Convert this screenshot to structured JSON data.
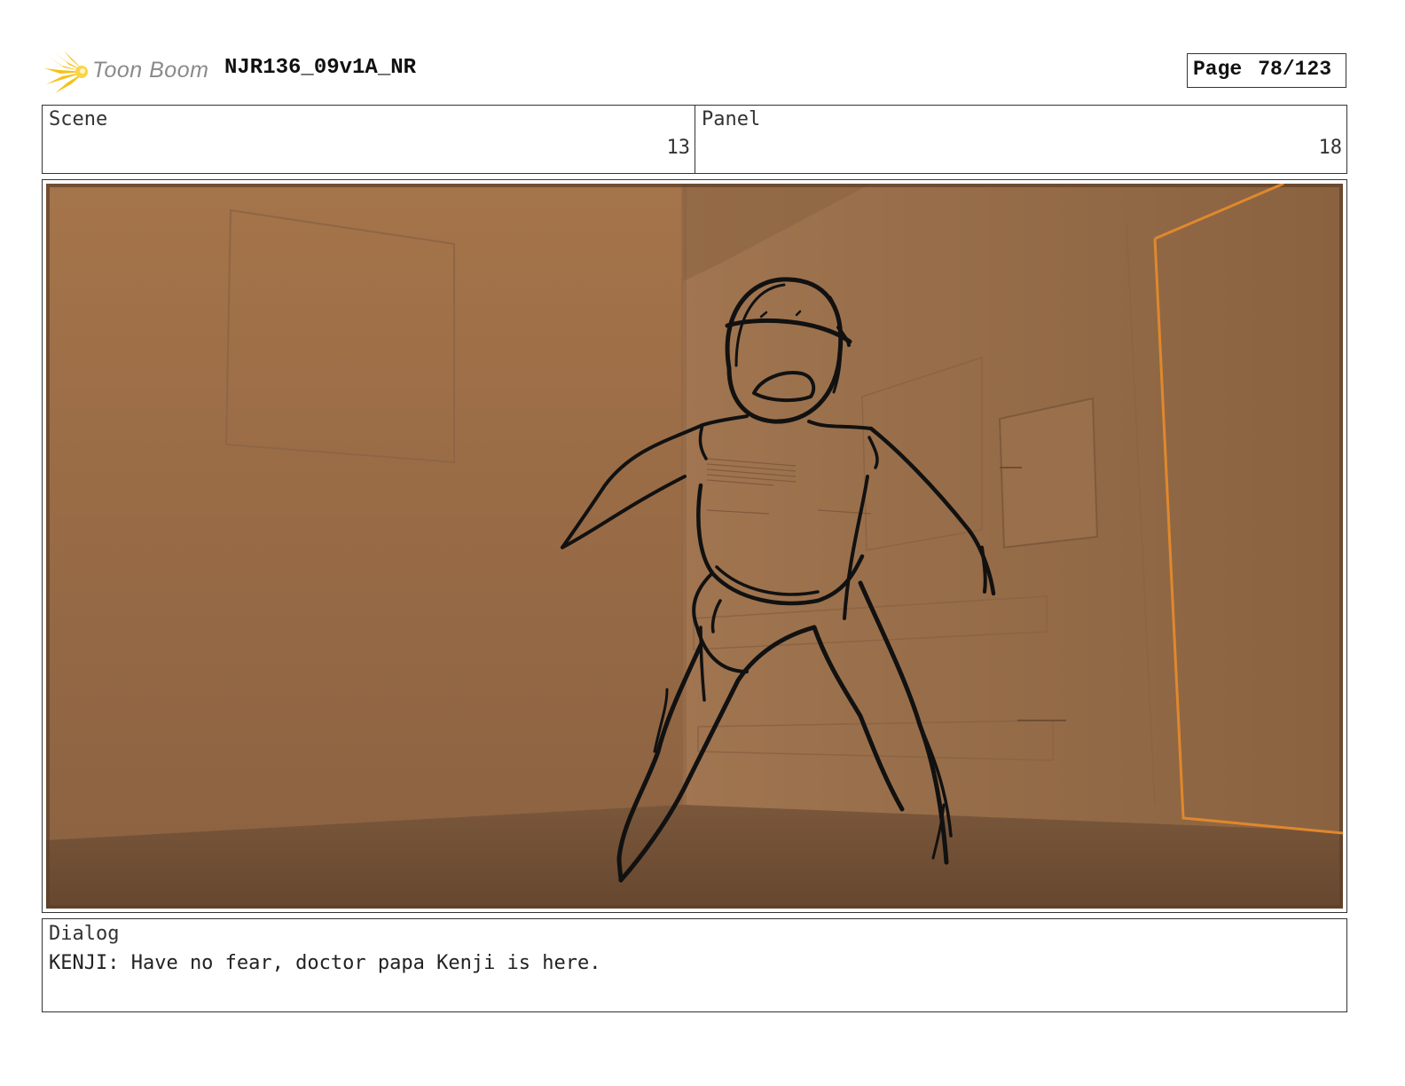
{
  "header": {
    "logo_text": "Toon Boom",
    "project_title": "NJR136_09v1A_NR",
    "page_label": "Page",
    "page_number": "78/123"
  },
  "scene": {
    "label": "Scene",
    "value": "13"
  },
  "panel": {
    "label": "Panel",
    "value": "18"
  },
  "dialog": {
    "label": "Dialog",
    "text": "KENJI: Have no fear, doctor papa Kenji is here."
  },
  "colors": {
    "logo_accent": "#f6c21a",
    "frame_tint": "#9b6b43",
    "door_frame": "#e0882c"
  },
  "icons": {
    "logo": "starburst-logo-icon"
  }
}
